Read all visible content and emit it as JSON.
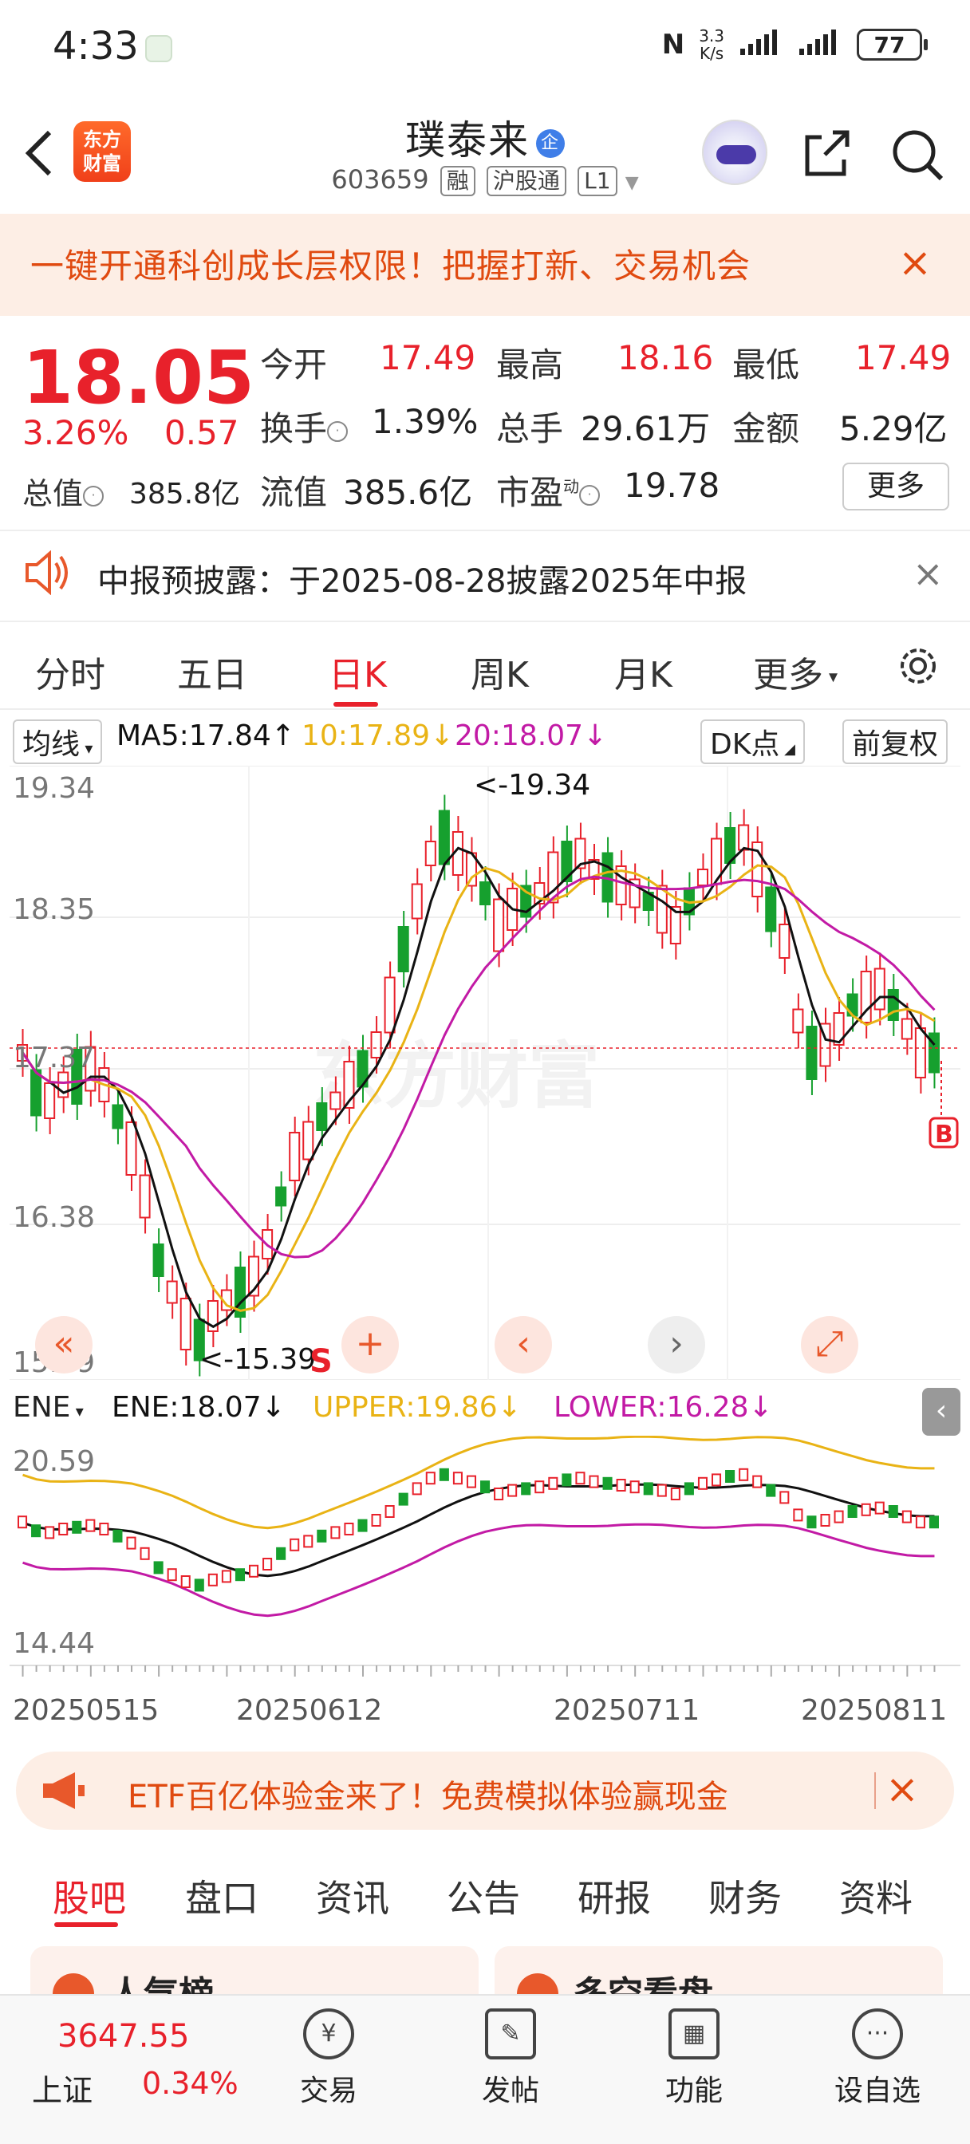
{
  "status_bar": {
    "time": "4:33",
    "speed_top": "3.3",
    "speed_bottom": "K/s",
    "battery": "77"
  },
  "header": {
    "logo_line1": "东方",
    "logo_line2": "财富",
    "title": "璞泰来",
    "title_badge": "企",
    "code": "603659",
    "tags": [
      "融",
      "沪股通",
      "L1"
    ]
  },
  "promo": {
    "text": "一键开通科创成长层权限！把握打新、交易机会",
    "close": "×"
  },
  "quote": {
    "price": "18.05",
    "pct": "3.26%",
    "change": "0.57",
    "open_label": "今开",
    "open": "17.49",
    "high_label": "最高",
    "high": "18.16",
    "low_label": "最低",
    "low": "17.49",
    "turnover_label": "换手",
    "turnover": "1.39%",
    "volume_label": "总手",
    "volume": "29.61万",
    "amount_label": "金额",
    "amount": "5.29亿",
    "mktcap_label": "总值",
    "mktcap": "385.8亿",
    "float_label": "流值",
    "float": "385.6亿",
    "pe_label": "市盈",
    "pe_sup": "动",
    "pe": "19.78",
    "more": "更多"
  },
  "notice": {
    "text": "中报预披露：于2025-08-28披露2025年中报",
    "close": "×"
  },
  "chart_tabs": [
    "分时",
    "五日",
    "日K",
    "周K",
    "月K",
    "更多"
  ],
  "chart_tabs_active": 2,
  "legend": {
    "ma_type": "均线",
    "ma5": "MA5:17.84↑",
    "ma10": "10:17.89↓",
    "ma20": "20:18.07↓",
    "dk": "DK点",
    "fq": "前复权"
  },
  "chart_labels": {
    "y1": "19.34",
    "y2": "18.35",
    "y3": "17.37",
    "y4": "16.38",
    "y5": "15.39",
    "max_annot": "<-19.34",
    "min_annot": "<-15.39",
    "s_mark": "S",
    "b_mark": "B",
    "sub_y_top": "20.59",
    "sub_y_bottom": "14.44",
    "dates": [
      "20250515",
      "20250612",
      "20250711",
      "20250811"
    ],
    "watermark": "东方财富"
  },
  "ene_legend": {
    "name": "ENE",
    "ene": "ENE:18.07↓",
    "upper": "UPPER:19.86↓",
    "lower": "LOWER:16.28↓"
  },
  "controls": [
    "«",
    "+",
    "‹",
    "›",
    "⤢"
  ],
  "colors": {
    "up": "#e8212b",
    "down": "#16a02e",
    "ma5": "#111111",
    "ma10": "#e9b315",
    "ma20": "#c21aa5"
  },
  "chart_data": {
    "type": "candlestick",
    "ylim": [
      15.39,
      19.34
    ],
    "ma_values": {
      "MA5": 17.84,
      "MA10": 17.89,
      "MA20": 18.07
    },
    "ene": {
      "ylim": [
        14.44,
        20.59
      ],
      "ENE": 18.07,
      "UPPER": 19.86,
      "LOWER": 16.28
    },
    "x_ticks": [
      "20250515",
      "20250612",
      "20250711",
      "20250811"
    ],
    "high_marker": 19.34,
    "low_marker": 15.39
  },
  "banner2": {
    "text": "ETF百亿体验金来了！免费模拟体验赢现金",
    "close": "×"
  },
  "bottom_tabs": [
    "股吧",
    "盘口",
    "资讯",
    "公告",
    "研报",
    "财务",
    "资料"
  ],
  "bottom_tabs_active": 0,
  "cards": {
    "left": "人气榜",
    "right": "多空看盘"
  },
  "index": {
    "name": "上证",
    "value": "3647.55",
    "pct": "0.34%"
  },
  "nav": [
    {
      "label": "交易",
      "icon": "¥"
    },
    {
      "label": "发帖",
      "icon": "✎"
    },
    {
      "label": "功能",
      "icon": "▦"
    },
    {
      "label": "设自选",
      "icon": "···"
    }
  ]
}
